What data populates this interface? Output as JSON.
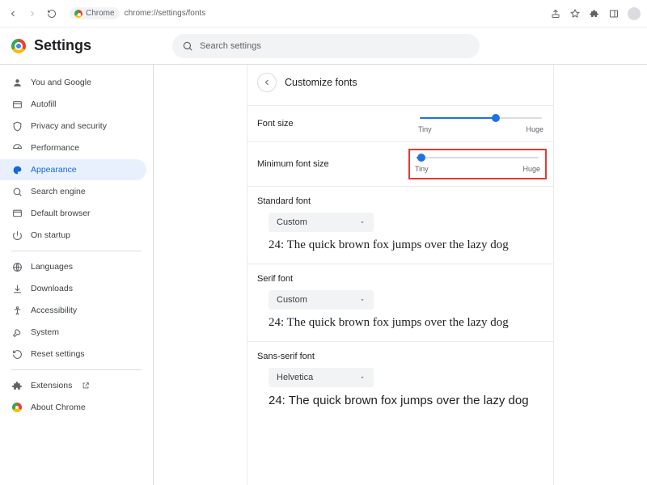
{
  "browser": {
    "url_host": "Chrome",
    "url_path": "chrome://settings/fonts"
  },
  "header": {
    "title": "Settings",
    "search_placeholder": "Search settings"
  },
  "sidebar": {
    "items": [
      {
        "label": "You and Google"
      },
      {
        "label": "Autofill"
      },
      {
        "label": "Privacy and security"
      },
      {
        "label": "Performance"
      },
      {
        "label": "Appearance"
      },
      {
        "label": "Search engine"
      },
      {
        "label": "Default browser"
      },
      {
        "label": "On startup"
      }
    ],
    "items2": [
      {
        "label": "Languages"
      },
      {
        "label": "Downloads"
      },
      {
        "label": "Accessibility"
      },
      {
        "label": "System"
      },
      {
        "label": "Reset settings"
      }
    ],
    "items3": [
      {
        "label": "Extensions"
      },
      {
        "label": "About Chrome"
      }
    ]
  },
  "panel": {
    "title": "Customize fonts",
    "font_size": {
      "label": "Font size",
      "min_label": "Tiny",
      "max_label": "Huge",
      "value_pct": 62
    },
    "min_font_size": {
      "label": "Minimum font size",
      "min_label": "Tiny",
      "max_label": "Huge",
      "value_pct": 4
    },
    "standard": {
      "label": "Standard font",
      "select": "Custom",
      "sample": "24: The quick brown fox jumps over the lazy dog"
    },
    "serif": {
      "label": "Serif font",
      "select": "Custom",
      "sample": "24: The quick brown fox jumps over the lazy dog"
    },
    "sans": {
      "label": "Sans-serif font",
      "select": "Helvetica",
      "sample": "24: The quick brown fox jumps over the lazy dog"
    }
  }
}
